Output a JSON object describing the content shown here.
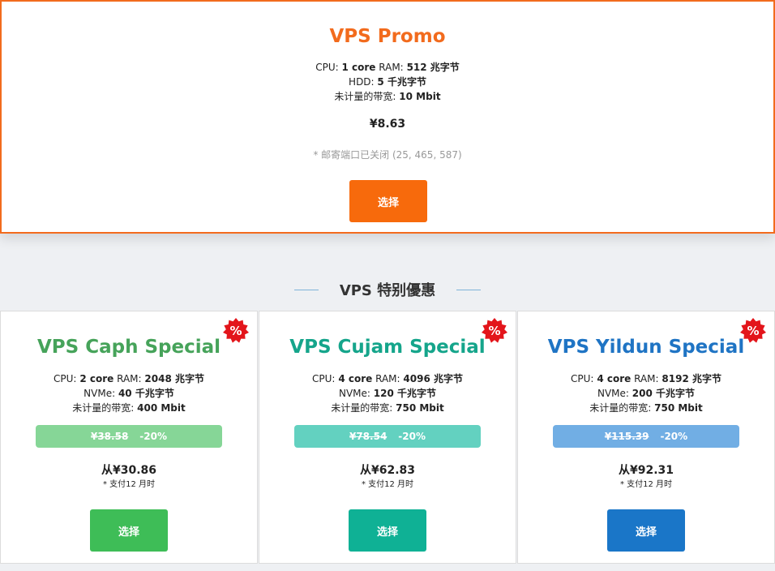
{
  "promo": {
    "title": "VPS Promo",
    "cpu_label": "CPU:",
    "cpu_value": "1 core",
    "ram_label": "RAM:",
    "ram_value": "512 兆字节",
    "disk_label": "HDD:",
    "disk_value": "5 千兆字节",
    "bw_label": "未计量的带宽:",
    "bw_value": "10 Mbit",
    "price": "¥8.63",
    "note": "* 邮寄端口已关闭 (25, 465, 587)",
    "button": "选择"
  },
  "section": {
    "heading": "VPS 特别優惠"
  },
  "cards": [
    {
      "title": "VPS Caph Special",
      "cpu_label": "CPU:",
      "cpu_value": "2 core",
      "ram_label": "RAM:",
      "ram_value": "2048 兆字节",
      "disk_label": "NVMe:",
      "disk_value": "40 千兆字节",
      "bw_label": "未计量的带宽:",
      "bw_value": "400 Mbit",
      "old_price": "¥38.58",
      "discount": "-20%",
      "price": "从¥30.86",
      "term": "*  支付12 月时",
      "button": "选择",
      "badge": "%"
    },
    {
      "title": "VPS Cujam Special",
      "cpu_label": "CPU:",
      "cpu_value": "4 core",
      "ram_label": "RAM:",
      "ram_value": "4096 兆字节",
      "disk_label": "NVMe:",
      "disk_value": "120 千兆字节",
      "bw_label": "未计量的带宽:",
      "bw_value": "750 Mbit",
      "old_price": "¥78.54",
      "discount": "-20%",
      "price": "从¥62.83",
      "term": "*  支付12 月时",
      "button": "选择",
      "badge": "%"
    },
    {
      "title": "VPS Yildun Special",
      "cpu_label": "CPU:",
      "cpu_value": "4 core",
      "ram_label": "RAM:",
      "ram_value": "8192 兆字节",
      "disk_label": "NVMe:",
      "disk_value": "200 千兆字节",
      "bw_label": "未计量的带宽:",
      "bw_value": "750 Mbit",
      "old_price": "¥115.39",
      "discount": "-20%",
      "price": "从¥92.31",
      "term": "*  支付12 月时",
      "button": "选择",
      "badge": "%"
    }
  ],
  "colors": {
    "promo_accent": "#f26b1d",
    "card1_accent": "#3ebd57",
    "card2_accent": "#0fb195",
    "card3_accent": "#1a76c8",
    "badge_red": "#e3151b"
  }
}
